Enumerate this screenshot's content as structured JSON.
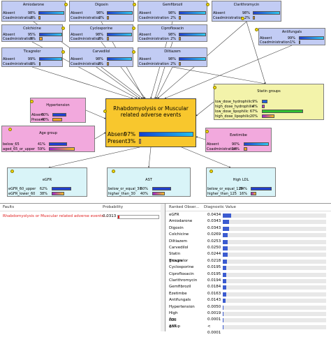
{
  "colors": {
    "node_blue": "#c2ccf4",
    "node_pink": "#f2a9dd",
    "node_yellow": "#f3f3aa",
    "node_cyan": "#d9f4f8",
    "target_orange": "#f8c72d",
    "fault_text": "#e02020",
    "diag_bar": "#3b5bd0"
  },
  "network": {
    "target": {
      "title_line1": "Rhabdomyolysis or Muscular",
      "title_line2": "related adverse events",
      "absent_label": "Absent",
      "absent_pct": "97%",
      "present_label": "Present",
      "present_pct": "3%",
      "absent_value": 97,
      "present_value": 3
    },
    "drugs": [
      {
        "name": "Amiodarone",
        "absent": "98%",
        "coad": "2%"
      },
      {
        "name": "Digoxin",
        "absent": "98%",
        "coad": "2%"
      },
      {
        "name": "Gemfibrozil",
        "absent": "98%",
        "coad": "2%"
      },
      {
        "name": "Clarithromycin",
        "absent": "98%",
        "coad": "2%"
      },
      {
        "name": "Colchicine",
        "absent": "95%",
        "coad": "5%"
      },
      {
        "name": "Cyclosporine",
        "absent": "98%",
        "coad": "2%"
      },
      {
        "name": "Ciprofloxacin",
        "absent": "98%",
        "coad": "2%"
      },
      {
        "name": "Antifungals",
        "absent": "99%",
        "coad": "1%"
      },
      {
        "name": "Ticagrelor",
        "absent": "99%",
        "coad": "1%"
      },
      {
        "name": "Carvedilol",
        "absent": "98%",
        "coad": "2%"
      },
      {
        "name": "Diltiazem",
        "absent": "98%",
        "coad": "2%"
      }
    ],
    "row_labels": {
      "absent": "Absent",
      "coad": "Coadministration"
    },
    "statin": {
      "title": "Statin groups",
      "rows": [
        {
          "label": "low_dose_hydrophilic",
          "pct": "9%",
          "value": 9
        },
        {
          "label": "high_dose_hydrophilic",
          "pct": "4%",
          "value": 4
        },
        {
          "label": "low_dose_lipophilic",
          "pct": "67%",
          "value": 67
        },
        {
          "label": "high_dose_lipophilic",
          "pct": "20%",
          "value": 20
        }
      ]
    },
    "hypertension": {
      "title": "Hypertension",
      "absent_label": "Absent",
      "absent_pct": "60%",
      "present_label": "Present",
      "present_pct": "40%"
    },
    "age": {
      "title": "Age group",
      "rows": [
        {
          "label": "below_65",
          "pct": "41%"
        },
        {
          "label": "aged_65_or_upper",
          "pct": "59%"
        }
      ]
    },
    "ezetimibe": {
      "title": "Ezetimibe",
      "absent_label": "Absent",
      "absent_pct": "90%",
      "coad_label": "Coadministration",
      "coad_pct": "10%"
    },
    "egfr": {
      "title": "eGFR",
      "rows": [
        {
          "label": "eGFR_60_upper",
          "pct": "62%"
        },
        {
          "label": "eGFR_lower_60",
          "pct": "38%"
        }
      ]
    },
    "ast": {
      "title": "AST",
      "rows": [
        {
          "label": "below_or_equal_30",
          "pct": "60%"
        },
        {
          "label": "higher_than_30",
          "pct": "40%"
        }
      ]
    },
    "ldl": {
      "title": "High LDL",
      "rows": [
        {
          "label": "below_or_equal_125",
          "pct": "84%"
        },
        {
          "label": "higher_than_125",
          "pct": "16%"
        }
      ]
    }
  },
  "faults_panel": {
    "col_faults": "Faults",
    "col_prob": "Probability",
    "fault_name": "Rhabdomyolysis or Muscular related adverse events:...",
    "fault_prob": "0.0313",
    "fault_prob_value": 0.0313
  },
  "ranked_panel": {
    "col_obs": "Ranked Obser...",
    "col_diag": "Diagnostic Value",
    "rows": [
      {
        "name": "eGFR",
        "value": "0.0434",
        "num": 0.0434
      },
      {
        "name": "Amiodarone",
        "value": "0.0343",
        "num": 0.0343
      },
      {
        "name": "Digoxin",
        "value": "0.0343",
        "num": 0.0343
      },
      {
        "name": "Colchicine",
        "value": "0.0269",
        "num": 0.0269
      },
      {
        "name": "Diltiazem",
        "value": "0.0253",
        "num": 0.0253
      },
      {
        "name": "Carvedilol",
        "value": "0.0250",
        "num": 0.025
      },
      {
        "name": "Statin groups",
        "value": "0.0244",
        "num": 0.0244
      },
      {
        "name": "Ticagrelor",
        "value": "0.0218",
        "num": 0.0218
      },
      {
        "name": "Cyclosporine",
        "value": "0.0195",
        "num": 0.0195
      },
      {
        "name": "Ciprofloxacin",
        "value": "0.0195",
        "num": 0.0195
      },
      {
        "name": "Clarithromycin",
        "value": "0.0194",
        "num": 0.0194
      },
      {
        "name": "Gemfibrozil",
        "value": "0.0184",
        "num": 0.0184
      },
      {
        "name": "Ezetimbe",
        "value": "0.0163",
        "num": 0.0163
      },
      {
        "name": "Antifungals",
        "value": "0.0143",
        "num": 0.0143
      },
      {
        "name": "Hypertension",
        "value": "0.0050",
        "num": 0.005
      },
      {
        "name": "High LDL",
        "value": "0.0019",
        "num": 0.0019
      },
      {
        "name": "Age group",
        "value": "0.0001",
        "num": 0.0001
      },
      {
        "name": "AST",
        "value": "< 0.0001",
        "num": 2e-05
      }
    ]
  }
}
